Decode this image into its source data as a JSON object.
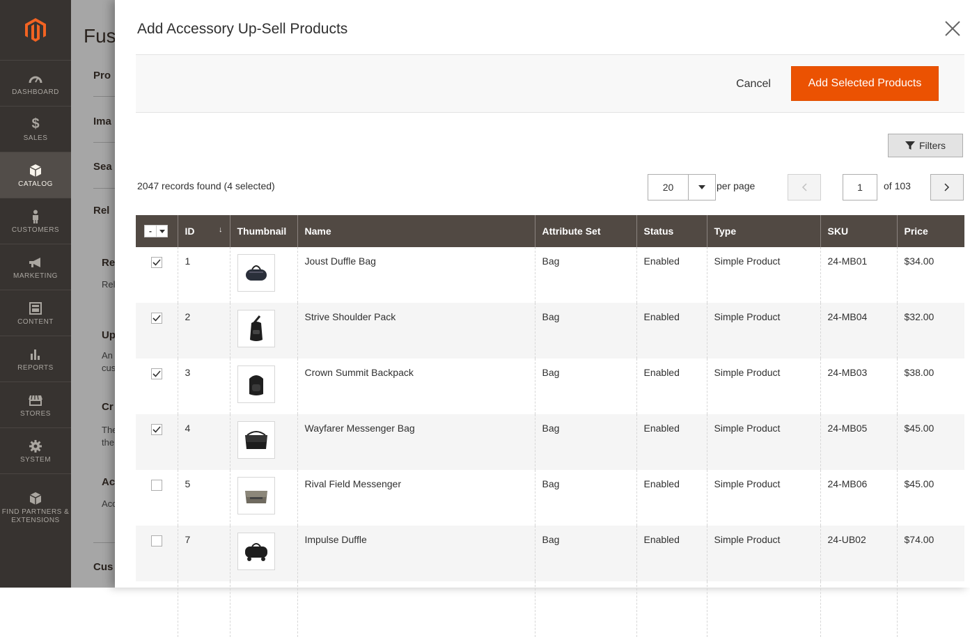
{
  "sidebar": {
    "items": [
      {
        "label": "DASHBOARD",
        "icon": "dashboard-icon"
      },
      {
        "label": "SALES",
        "icon": "dollar-icon"
      },
      {
        "label": "CATALOG",
        "icon": "box-icon"
      },
      {
        "label": "CUSTOMERS",
        "icon": "person-icon"
      },
      {
        "label": "MARKETING",
        "icon": "megaphone-icon"
      },
      {
        "label": "CONTENT",
        "icon": "layout-icon"
      },
      {
        "label": "REPORTS",
        "icon": "bar-chart-icon"
      },
      {
        "label": "STORES",
        "icon": "storefront-icon"
      },
      {
        "label": "SYSTEM",
        "icon": "gear-icon"
      },
      {
        "label": "FIND PARTNERS & EXTENSIONS",
        "icon": "partners-icon"
      }
    ]
  },
  "background_page": {
    "title": "Fus",
    "sections": [
      "Pro",
      "Ima",
      "Sea",
      "Rel",
      "Re",
      "Rel",
      "Up",
      "An",
      "cus",
      "Cr",
      "The",
      "the",
      "Ac",
      "Acc",
      "Cus"
    ]
  },
  "modal": {
    "title": "Add Accessory Up-Sell Products",
    "cancel_label": "Cancel",
    "add_label": "Add Selected Products",
    "filters_label": "Filters",
    "records_text": "2047 records found (4 selected)",
    "per_page_value": "20",
    "per_page_label": "per page",
    "page_current": "1",
    "page_total_text": "of 103"
  },
  "table": {
    "columns": [
      "ID",
      "Thumbnail",
      "Name",
      "Attribute Set",
      "Status",
      "Type",
      "SKU",
      "Price"
    ],
    "rows": [
      {
        "checked": true,
        "id": "1",
        "name": "Joust Duffle Bag",
        "attribute_set": "Bag",
        "status": "Enabled",
        "type": "Simple Product",
        "sku": "24-MB01",
        "price": "$34.00",
        "thumb": "duffle-bag-icon"
      },
      {
        "checked": true,
        "id": "2",
        "name": "Strive Shoulder Pack",
        "attribute_set": "Bag",
        "status": "Enabled",
        "type": "Simple Product",
        "sku": "24-MB04",
        "price": "$32.00",
        "thumb": "shoulder-pack-icon"
      },
      {
        "checked": true,
        "id": "3",
        "name": "Crown Summit Backpack",
        "attribute_set": "Bag",
        "status": "Enabled",
        "type": "Simple Product",
        "sku": "24-MB03",
        "price": "$38.00",
        "thumb": "backpack-icon"
      },
      {
        "checked": true,
        "id": "4",
        "name": "Wayfarer Messenger Bag",
        "attribute_set": "Bag",
        "status": "Enabled",
        "type": "Simple Product",
        "sku": "24-MB05",
        "price": "$45.00",
        "thumb": "messenger-bag-icon"
      },
      {
        "checked": false,
        "id": "5",
        "name": "Rival Field Messenger",
        "attribute_set": "Bag",
        "status": "Enabled",
        "type": "Simple Product",
        "sku": "24-MB06",
        "price": "$45.00",
        "thumb": "field-messenger-icon"
      },
      {
        "checked": false,
        "id": "7",
        "name": "Impulse Duffle",
        "attribute_set": "Bag",
        "status": "Enabled",
        "type": "Simple Product",
        "sku": "24-UB02",
        "price": "$74.00",
        "thumb": "rolling-duffle-icon"
      }
    ]
  },
  "colors": {
    "accent": "#eb5202",
    "sidebar_bg": "#373330",
    "header_bg": "#514943"
  }
}
